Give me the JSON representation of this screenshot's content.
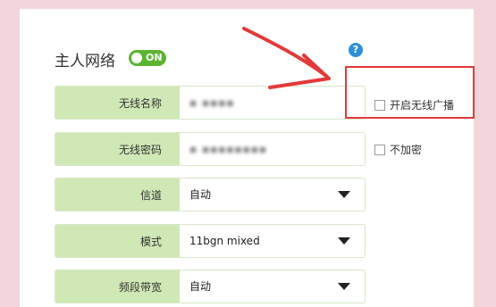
{
  "section": {
    "title": "主人网络",
    "toggle_label": "ON"
  },
  "help": {
    "glyph": "?"
  },
  "rows": [
    {
      "label": "无线名称",
      "value": ""
    },
    {
      "label": "无线密码",
      "value": ""
    },
    {
      "label": "信道",
      "value": "自动"
    },
    {
      "label": "模式",
      "value": "11bgn mixed"
    },
    {
      "label": "频段带宽",
      "value": "自动"
    }
  ],
  "checks": {
    "broadcast": "开启无线广播",
    "no_encrypt": "不加密"
  },
  "colors": {
    "background": "#f3d6dc",
    "label_bg": "#cfe8b5",
    "toggle_on": "#5cb531",
    "annotation": "#e23a3a",
    "help": "#2f8fd8"
  }
}
